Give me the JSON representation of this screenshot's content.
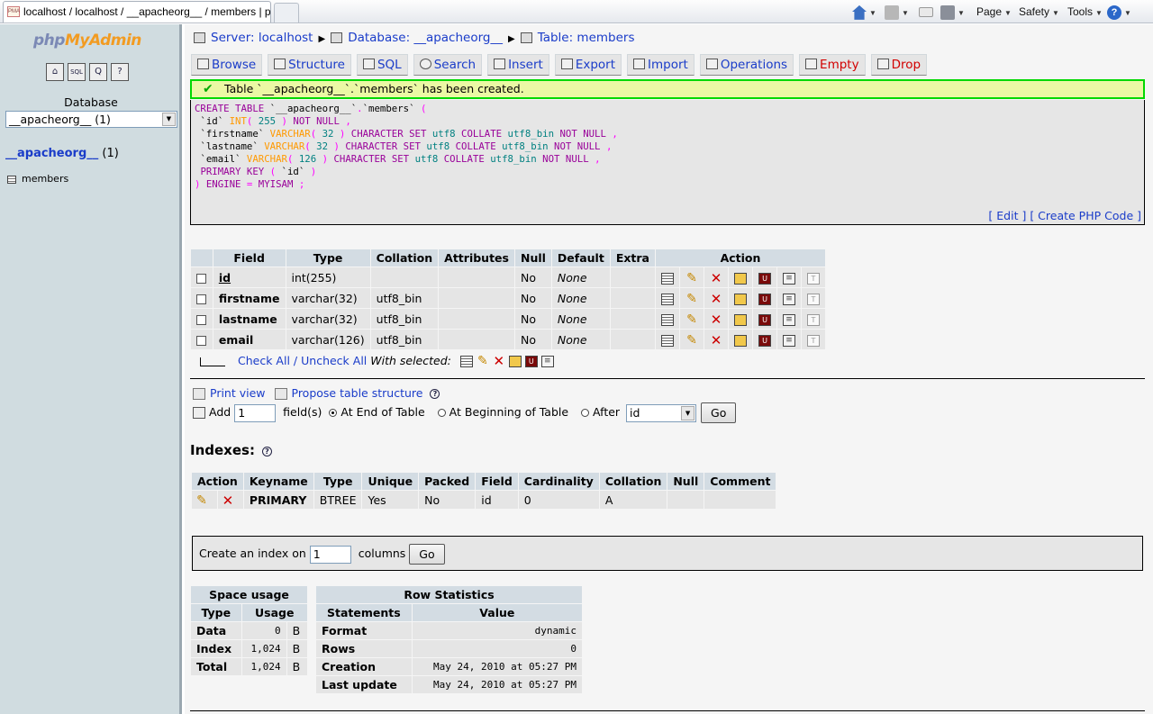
{
  "browser": {
    "tab_title": "localhost / localhost / __apacheorg__ / members | ph...",
    "tab_favicon": "PMA",
    "commands": {
      "page": "Page",
      "safety": "Safety",
      "tools": "Tools"
    }
  },
  "sidebar": {
    "logo": {
      "php": "php",
      "my": "My",
      "admin": "Admin"
    },
    "icons": [
      "home-icon",
      "sql-icon",
      "query-icon",
      "docs-icon"
    ],
    "database_label": "Database",
    "database_select": "__apacheorg__ (1)",
    "db_link": "__apacheorg__",
    "db_count": "(1)",
    "tables": [
      "members"
    ]
  },
  "breadcrumb": {
    "server": "Server: localhost",
    "database": "Database: __apacheorg__",
    "table": "Table: members"
  },
  "tabs": [
    "Browse",
    "Structure",
    "SQL",
    "Search",
    "Insert",
    "Export",
    "Import",
    "Operations",
    "Empty",
    "Drop"
  ],
  "notice": "Table `__apacheorg__`.`members` has been created.",
  "sql": {
    "edit_link": "[ Edit ]",
    "php_link": "[ Create PHP Code ]"
  },
  "structure": {
    "headers": [
      "Field",
      "Type",
      "Collation",
      "Attributes",
      "Null",
      "Default",
      "Extra",
      "Action"
    ],
    "rows": [
      {
        "field": "id",
        "type": "int(255)",
        "collation": "",
        "attributes": "",
        "null": "No",
        "default": "None",
        "extra": ""
      },
      {
        "field": "firstname",
        "type": "varchar(32)",
        "collation": "utf8_bin",
        "attributes": "",
        "null": "No",
        "default": "None",
        "extra": ""
      },
      {
        "field": "lastname",
        "type": "varchar(32)",
        "collation": "utf8_bin",
        "attributes": "",
        "null": "No",
        "default": "None",
        "extra": ""
      },
      {
        "field": "email",
        "type": "varchar(126)",
        "collation": "utf8_bin",
        "attributes": "",
        "null": "No",
        "default": "None",
        "extra": ""
      }
    ],
    "check_all": "Check All",
    "separator": "/",
    "uncheck_all": "Uncheck All",
    "with_selected": "With selected:"
  },
  "tools": {
    "print_view": "Print view",
    "propose": "Propose table structure",
    "add_label": "Add",
    "add_value": "1",
    "fields_label": "field(s)",
    "at_end": "At End of Table",
    "at_begin": "At Beginning of Table",
    "after": "After",
    "after_select": "id",
    "go": "Go"
  },
  "indexes": {
    "title": "Indexes:",
    "headers": [
      "Action",
      "Keyname",
      "Type",
      "Unique",
      "Packed",
      "Field",
      "Cardinality",
      "Collation",
      "Null",
      "Comment"
    ],
    "rows": [
      {
        "keyname": "PRIMARY",
        "type": "BTREE",
        "unique": "Yes",
        "packed": "No",
        "field": "id",
        "cardinality": "0",
        "collation": "A",
        "null": "",
        "comment": ""
      }
    ],
    "create_label": "Create an index on",
    "create_value": "1",
    "columns_label": "columns",
    "go": "Go"
  },
  "space_usage": {
    "title": "Space usage",
    "headers": [
      "Type",
      "Usage"
    ],
    "rows": [
      {
        "type": "Data",
        "value": "0",
        "unit": "B"
      },
      {
        "type": "Index",
        "value": "1,024",
        "unit": "B"
      },
      {
        "type": "Total",
        "value": "1,024",
        "unit": "B"
      }
    ]
  },
  "row_stats": {
    "title": "Row Statistics",
    "headers": [
      "Statements",
      "Value"
    ],
    "rows": [
      {
        "label": "Format",
        "value": "dynamic"
      },
      {
        "label": "Rows",
        "value": "0"
      },
      {
        "label": "Creation",
        "value": "May 24, 2010 at 05:27 PM"
      },
      {
        "label": "Last update",
        "value": "May 24, 2010 at 05:27 PM"
      }
    ]
  }
}
